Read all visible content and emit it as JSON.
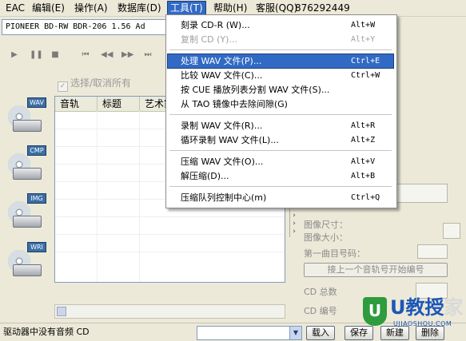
{
  "menubar": {
    "items": [
      {
        "label": "EAC"
      },
      {
        "label": "编辑(E)"
      },
      {
        "label": "操作(A)"
      },
      {
        "label": "数据库(D)"
      },
      {
        "label": "工具(T)"
      },
      {
        "label": "帮助(H)"
      },
      {
        "label": "客服(QQ)"
      }
    ],
    "phone": "876292449"
  },
  "drive": {
    "selected": "PIONEER BD-RW   BDR-206 1.56   Ad"
  },
  "toolbar": {
    "select_all_label": "选择/取消所有"
  },
  "sidebar": {
    "tags": [
      "WAV",
      "CMP",
      "IMG",
      "WRI"
    ]
  },
  "table": {
    "columns": [
      "音轨",
      "标题",
      "艺术家"
    ]
  },
  "right_panel": {
    "image_size_label": "图像尺寸：",
    "image_size2_label": "图像大小：",
    "first_track_label": "第一曲目号码：",
    "continue_button": "接上一个音轨号开始编号",
    "cd_total_label": "CD 总数",
    "cd_number_label": "CD 编号"
  },
  "tools_menu": {
    "items": [
      {
        "label": "刻录 CD-R (W)...",
        "shortcut": "Alt+W",
        "state": "normal"
      },
      {
        "label": "复制 CD (Y)...",
        "shortcut": "Alt+Y",
        "state": "disabled"
      },
      {
        "label": "处理 WAV 文件(P)...",
        "shortcut": "Ctrl+E",
        "state": "highlighted"
      },
      {
        "label": "比较 WAV 文件(C)...",
        "shortcut": "Ctrl+W",
        "state": "normal"
      },
      {
        "label": "按 CUE 播放列表分割 WAV 文件(S)...",
        "shortcut": "",
        "state": "normal"
      },
      {
        "label": "从 TAO 镜像中去除间隙(G)",
        "shortcut": "",
        "state": "normal"
      },
      {
        "label": "录制 WAV 文件(R)...",
        "shortcut": "Alt+R",
        "state": "normal"
      },
      {
        "label": "循环录制 WAV 文件(L)...",
        "shortcut": "Alt+Z",
        "state": "normal"
      },
      {
        "label": "压缩 WAV 文件(O)...",
        "shortcut": "Alt+V",
        "state": "normal"
      },
      {
        "label": "解压缩(D)...",
        "shortcut": "Alt+B",
        "state": "normal"
      },
      {
        "label": "压缩队列控制中心(m)",
        "shortcut": "Ctrl+Q",
        "state": "normal"
      }
    ]
  },
  "status": {
    "message": "驱动器中没有音频 CD",
    "buttons": [
      "载入",
      "保存",
      "新建",
      "删除"
    ]
  },
  "watermark": {
    "brand": "U教授",
    "tail": "家",
    "url": "UJIAOSHOU.COM"
  }
}
